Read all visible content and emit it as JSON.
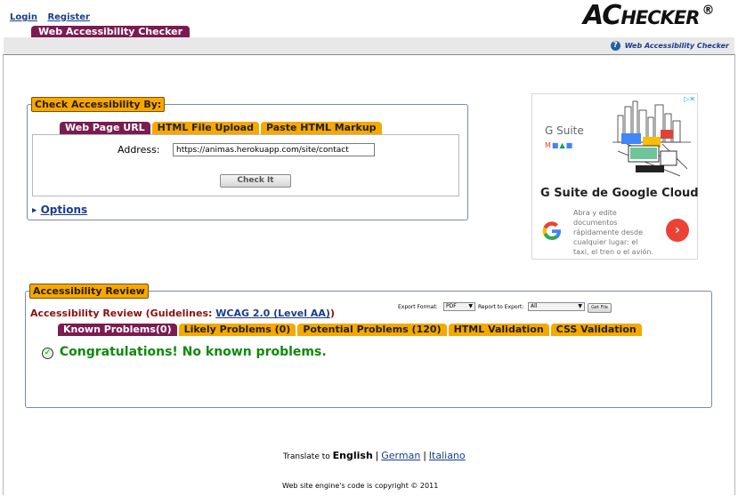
{
  "header": {
    "login": "Login",
    "register": "Register",
    "logo_ac": "AC",
    "logo_checker": "HECKER",
    "logo_reg": "®",
    "title_tab": "Web Accessibility Checker",
    "right_link": "Web Accessibility Checker"
  },
  "check": {
    "legend": "Check Accessibility By:",
    "tabs": [
      "Web Page URL",
      "HTML File Upload",
      "Paste HTML Markup"
    ],
    "address_label": "Address:",
    "address_value": "https://animas.herokuapp.com/site/contact",
    "check_button": "Check It",
    "options": "Options"
  },
  "ad": {
    "brand": "G Suite",
    "headline": "G Suite de Google Cloud",
    "body": "Abra y edite documentos rápidamente desde cualquier lugar: el taxi, el tren o el avión."
  },
  "review": {
    "legend": "Accessibility Review",
    "heading_prefix": "Accessibility Review (Guidelines: ",
    "guideline_link": "WCAG 2.0 (Level AA)",
    "heading_suffix": ")",
    "export_format_label": "Export Format:",
    "export_format_value": "PDF",
    "report_label": "Report to Export:",
    "report_value": "All",
    "get_file": "Get File",
    "tabs": [
      "Known Problems(0)",
      "Likely Problems (0)",
      "Potential Problems (120)",
      "HTML Validation",
      "CSS Validation"
    ],
    "message": "Congratulations! No known problems."
  },
  "footer": {
    "translate_to": "Translate to",
    "english": "English",
    "german": "German",
    "italiano": "Italiano",
    "sep": "|",
    "copyright": "Web site engine's code is copyright © 2011"
  },
  "colors": {
    "accent": "#7a1c52",
    "tab_orange": "#f5a800",
    "success_green": "#0d8a0d",
    "link_blue": "#1a3c8c"
  }
}
